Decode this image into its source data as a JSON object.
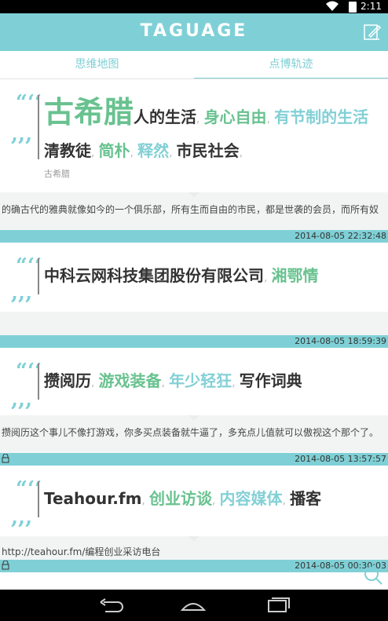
{
  "status": {
    "time": "2:11"
  },
  "app": {
    "title": "TAGUAGE"
  },
  "tabs": [
    {
      "label": "思维地图"
    },
    {
      "label": "点博轨迹"
    }
  ],
  "posts": [
    {
      "tags": [
        {
          "text": "古希腊",
          "color": "#68c28f"
        },
        {
          "text": "人的生活",
          "color": "#333333"
        },
        {
          "text": "身心自由",
          "color": "#68c28f"
        },
        {
          "text": "有节制的生活",
          "color": "#82d0d6"
        },
        {
          "text": "清教徒",
          "color": "#333333"
        },
        {
          "text": "简朴",
          "color": "#68c28f"
        },
        {
          "text": "释然",
          "color": "#82d0d6"
        },
        {
          "text": "市民社会",
          "color": "#333333"
        }
      ],
      "source": "古希腊",
      "description": "的确古代的雅典就像如今的一个俱乐部，所有生而自由的市民，都是世袭的会员，而所有奴",
      "date": "2014-08-05 22:32:48"
    },
    {
      "tags": [
        {
          "text": "中科云网科技集团股份有限公司",
          "color": "#333333"
        },
        {
          "text": "湘鄂情",
          "color": "#68c28f"
        }
      ],
      "description": "",
      "date": "2014-08-05 18:59:39"
    },
    {
      "tags": [
        {
          "text": "攒阅历",
          "color": "#333333"
        },
        {
          "text": "游戏装备",
          "color": "#68c28f"
        },
        {
          "text": "年少轻狂",
          "color": "#82d0d6"
        },
        {
          "text": "写作词典",
          "color": "#333333"
        }
      ],
      "description": "攒阅历这个事儿不像打游戏，你多买点装备就牛逼了，多充点儿值就可以傲视这个那个了。",
      "date": "2014-08-05 13:57:57"
    },
    {
      "tags": [
        {
          "text": "Teahour.fm",
          "color": "#333333"
        },
        {
          "text": "创业访谈",
          "color": "#68c28f"
        },
        {
          "text": "内容媒体",
          "color": "#82d0d6"
        },
        {
          "text": "播客",
          "color": "#333333"
        }
      ],
      "description": "http://teahour.fm/编程创业采访电台",
      "date": "2014-08-05 00:30:03"
    }
  ]
}
